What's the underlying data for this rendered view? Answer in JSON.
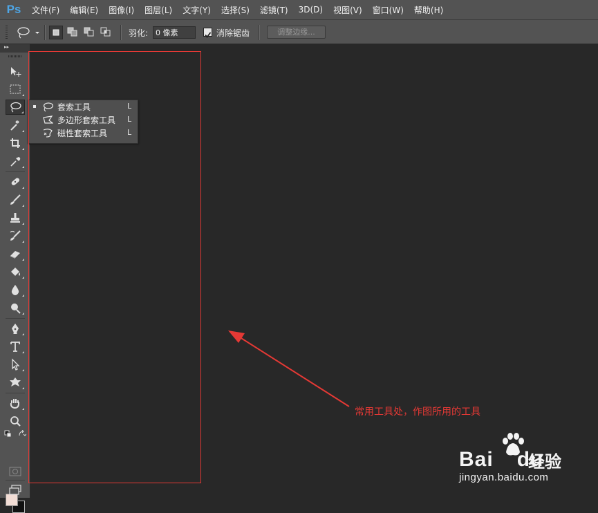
{
  "app": {
    "logo_text": "Ps"
  },
  "menu": [
    "文件(F)",
    "编辑(E)",
    "图像(I)",
    "图层(L)",
    "文字(Y)",
    "选择(S)",
    "滤镜(T)",
    "3D(D)",
    "视图(V)",
    "窗口(W)",
    "帮助(H)"
  ],
  "options": {
    "feather_label": "羽化:",
    "feather_value": "0 像素",
    "antialias_label": "消除锯齿",
    "antialias_checked": true,
    "refine_edge_label": "调整边缘..."
  },
  "flyout": {
    "items": [
      {
        "label": "套索工具",
        "shortcut": "L",
        "selected": true,
        "icon": "lasso-icon"
      },
      {
        "label": "多边形套索工具",
        "shortcut": "L",
        "selected": false,
        "icon": "polygonal-lasso-icon"
      },
      {
        "label": "磁性套索工具",
        "shortcut": "L",
        "selected": false,
        "icon": "magnetic-lasso-icon"
      }
    ]
  },
  "tools": [
    "move-icon",
    "marquee-icon",
    "lasso-icon",
    "magic-wand-icon",
    "crop-icon",
    "eyedropper-icon",
    "healing-brush-icon",
    "brush-icon",
    "clone-stamp-icon",
    "history-brush-icon",
    "eraser-icon",
    "paint-bucket-icon",
    "blur-icon",
    "dodge-icon",
    "pen-icon",
    "type-icon",
    "path-selection-icon",
    "shape-icon",
    "hand-icon",
    "zoom-icon"
  ],
  "colors": {
    "foreground": "#f2ddd5",
    "background": "#111111",
    "annotation": "#e53935",
    "ui_gray": "#535353",
    "canvas": "#282828"
  },
  "annotation": {
    "text": "常用工具处，作图所用的工具"
  },
  "watermark": {
    "brand": "Bai",
    "brand2": "du",
    "product": "经验",
    "url": "jingyan.baidu.com"
  }
}
